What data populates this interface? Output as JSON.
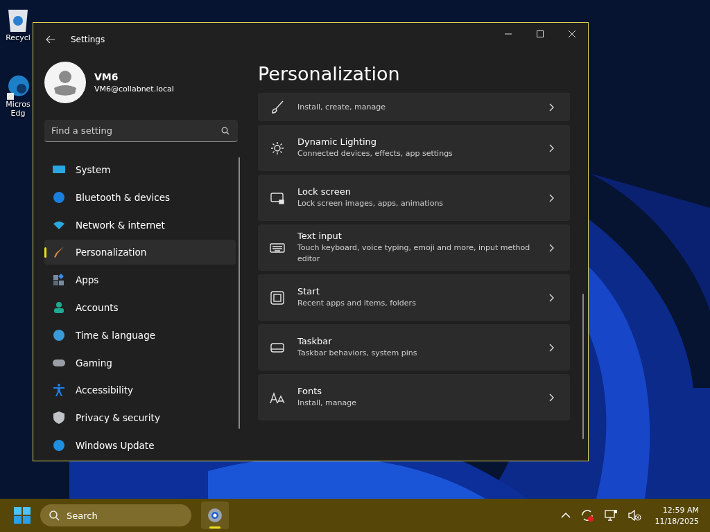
{
  "desktop_icons": [
    {
      "label": "Recycl"
    },
    {
      "label": "Micros Edg"
    }
  ],
  "window": {
    "title": "Settings"
  },
  "account": {
    "name": "VM6",
    "email": "VM6@collabnet.local"
  },
  "search": {
    "placeholder": "Find a setting"
  },
  "sidebar": {
    "items": [
      {
        "label": "System",
        "selected": false
      },
      {
        "label": "Bluetooth & devices",
        "selected": false
      },
      {
        "label": "Network & internet",
        "selected": false
      },
      {
        "label": "Personalization",
        "selected": true
      },
      {
        "label": "Apps",
        "selected": false
      },
      {
        "label": "Accounts",
        "selected": false
      },
      {
        "label": "Time & language",
        "selected": false
      },
      {
        "label": "Gaming",
        "selected": false
      },
      {
        "label": "Accessibility",
        "selected": false
      },
      {
        "label": "Privacy & security",
        "selected": false
      },
      {
        "label": "Windows Update",
        "selected": false
      }
    ]
  },
  "page_title": "Personalization",
  "settings": [
    {
      "description": "Install, create, manage"
    },
    {
      "title": "Dynamic Lighting",
      "description": "Connected devices, effects, app settings"
    },
    {
      "title": "Lock screen",
      "description": "Lock screen images, apps, animations"
    },
    {
      "title": "Text input",
      "description": "Touch keyboard, voice typing, emoji and more, input method editor"
    },
    {
      "title": "Start",
      "description": "Recent apps and items, folders"
    },
    {
      "title": "Taskbar",
      "description": "Taskbar behaviors, system pins"
    },
    {
      "title": "Fonts",
      "description": "Install, manage"
    }
  ],
  "taskbar": {
    "search_label": "Search",
    "time": "12:59 AM",
    "date": "11/18/2025"
  }
}
